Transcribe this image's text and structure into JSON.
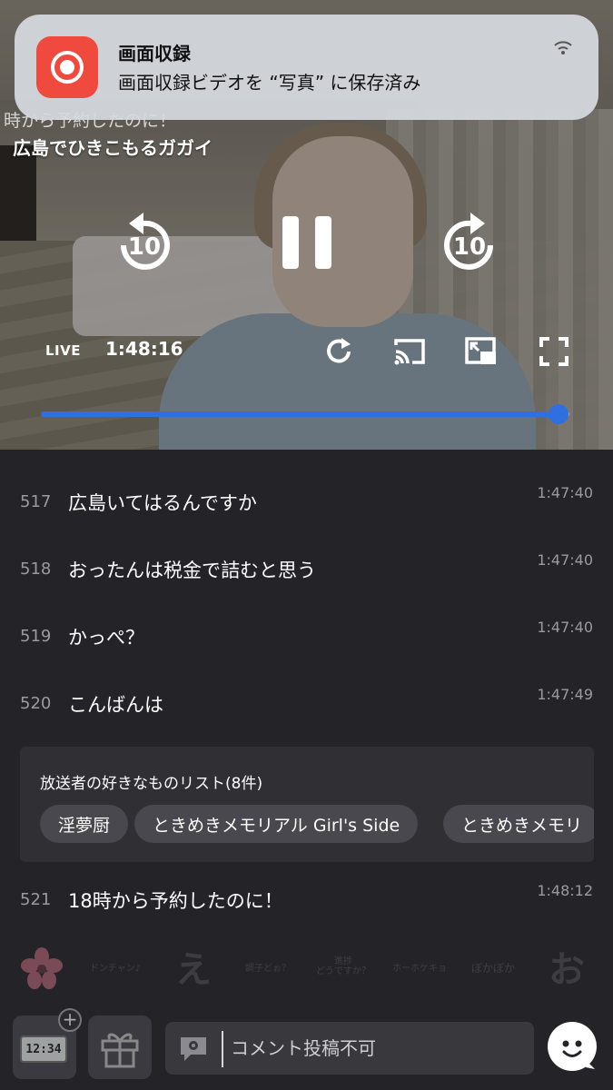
{
  "notification": {
    "app_name": "画面収録",
    "message": "画面収録ビデオを “写真” に保存済み",
    "icon": "screen-record-icon",
    "signal_icon": "wifi-icon"
  },
  "player": {
    "title_partial": "時から予約したのに！",
    "title": "広島でひきこもるガガイ",
    "live_label": "LIVE",
    "time": "1:48:16",
    "rewind_label": "10",
    "forward_label": "10",
    "progress": 0.98,
    "accent_color": "#2f6fe0"
  },
  "comments": [
    {
      "num": "517",
      "text": "広島いてはるんですか",
      "time": "1:47:40"
    },
    {
      "num": "518",
      "text": "おったんは税金で詰むと思う",
      "time": "1:47:40"
    },
    {
      "num": "519",
      "text": "かっぺ？",
      "time": "1:47:40"
    },
    {
      "num": "520",
      "text": "こんばんは",
      "time": "1:47:49"
    },
    {
      "num": "521",
      "text": "18時から予約したのに！",
      "time": "1:48:12"
    }
  ],
  "favorites": {
    "title": "放送者の好きなものリスト(8件)",
    "items": [
      "淫夢厨",
      "ときめきメモリアル Girl's Side",
      "ときめきメモリ"
    ]
  },
  "stamps": {
    "dontyan": "ドンチャン♪",
    "e": "え",
    "choushi": "調子どぉ？",
    "shinchoku1": "進捗",
    "shinchoku2": "どうですか？",
    "hohokekyo": "ホーホケキョ",
    "pokapoka": "ぽかぽか",
    "o": "お"
  },
  "bottom_bar": {
    "clock_display": "12:34",
    "comment_placeholder": "コメント投稿不可"
  }
}
